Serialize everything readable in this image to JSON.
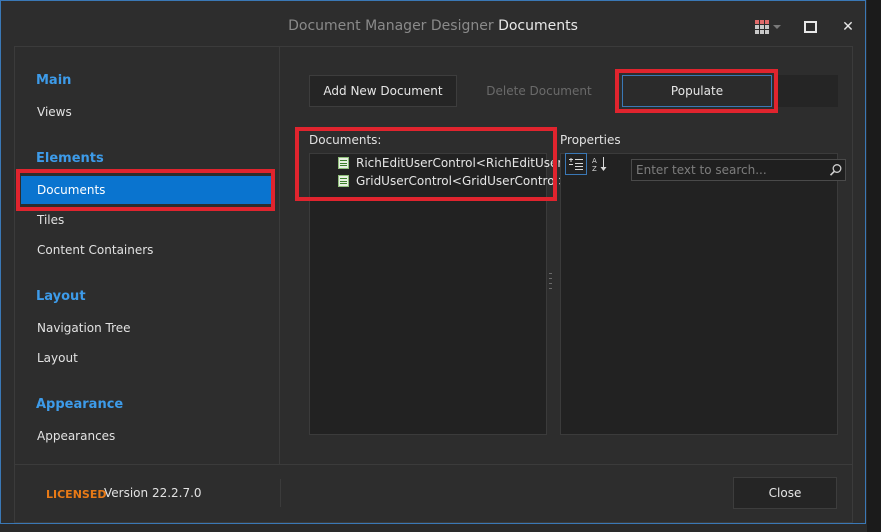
{
  "window": {
    "title_prefix": "Document Manager Designer",
    "title_section": "Documents",
    "maximize_label": "□",
    "close_label": "✕"
  },
  "sidebar": {
    "groups": [
      {
        "title": "Main",
        "items": [
          "Views"
        ]
      },
      {
        "title": "Elements",
        "items": [
          "Documents",
          "Tiles",
          "Content Containers"
        ]
      },
      {
        "title": "Layout",
        "items": [
          "Navigation Tree",
          "Layout"
        ]
      },
      {
        "title": "Appearance",
        "items": [
          "Appearances"
        ]
      }
    ],
    "selected": "Documents"
  },
  "toolbar": {
    "add_label": "Add New Document",
    "delete_label": "Delete Document",
    "populate_label": "Populate"
  },
  "documents": {
    "label": "Documents:",
    "items": [
      "RichEditUserControl<RichEditUserC",
      "GridUserControl<GridUserControl>"
    ]
  },
  "properties": {
    "label": "Properties",
    "search_placeholder": "Enter text to search..."
  },
  "footer": {
    "licensed": "LICENSED",
    "version": "Version 22.2.7.0",
    "close_label": "Close"
  },
  "colors": {
    "accent": "#0a74cf",
    "highlight": "#e0242e",
    "group_title": "#3d9be9",
    "licensed": "#e87a16"
  }
}
